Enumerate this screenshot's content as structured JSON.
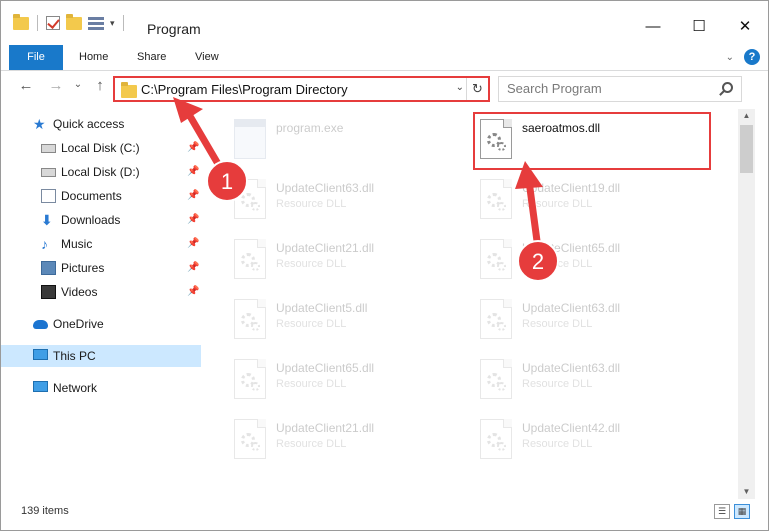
{
  "titlebar": {
    "title": "Program",
    "minimize": "—",
    "maximize": "☐",
    "close": "✕"
  },
  "ribbon": {
    "tabs": [
      "File",
      "Home",
      "Share",
      "View"
    ],
    "help": "?"
  },
  "nav": {
    "back": "←",
    "forward": "→",
    "recent": "⌄",
    "up": "↑",
    "address": "C:\\Program Files\\Program Directory",
    "search_placeholder": "Search Program"
  },
  "sidebar": {
    "items": [
      {
        "label": "Quick access",
        "icon": "star-icon",
        "pinned": false
      },
      {
        "label": "Local Disk (C:)",
        "icon": "drive-icon",
        "pinned": true
      },
      {
        "label": "Local Disk (D:)",
        "icon": "drive-icon",
        "pinned": true
      },
      {
        "label": "Documents",
        "icon": "documents-icon",
        "pinned": true
      },
      {
        "label": "Downloads",
        "icon": "download-icon",
        "pinned": true
      },
      {
        "label": "Music",
        "icon": "music-icon",
        "pinned": true
      },
      {
        "label": "Pictures",
        "icon": "pictures-icon",
        "pinned": true
      },
      {
        "label": "Videos",
        "icon": "videos-icon",
        "pinned": true
      },
      {
        "label": "OneDrive",
        "icon": "onedrive-icon",
        "pinned": false
      },
      {
        "label": "This PC",
        "icon": "this-pc-icon",
        "pinned": false,
        "selected": true
      },
      {
        "label": "Network",
        "icon": "network-icon",
        "pinned": false
      }
    ]
  },
  "files": [
    {
      "name": "program.exe",
      "type": "",
      "icon": "exe-icon",
      "dim": true
    },
    {
      "name": "saeroatmos.dll",
      "type": "",
      "icon": "dll-icon",
      "dim": false,
      "highlighted": true
    },
    {
      "name": "UpdateClient63.dll",
      "type": "Resource DLL",
      "icon": "dll-icon",
      "dim": true
    },
    {
      "name": "UpdateClient19.dll",
      "type": "Resource DLL",
      "icon": "dll-icon",
      "dim": true
    },
    {
      "name": "UpdateClient21.dll",
      "type": "Resource DLL",
      "icon": "dll-icon",
      "dim": true
    },
    {
      "name": "UpdateClient65.dll",
      "type": "Resource DLL",
      "icon": "dll-icon",
      "dim": true
    },
    {
      "name": "UpdateClient5.dll",
      "type": "Resource DLL",
      "icon": "dll-icon",
      "dim": true
    },
    {
      "name": "UpdateClient63.dll",
      "type": "Resource DLL",
      "icon": "dll-icon",
      "dim": true
    },
    {
      "name": "UpdateClient65.dll",
      "type": "Resource DLL",
      "icon": "dll-icon",
      "dim": true
    },
    {
      "name": "UpdateClient63.dll",
      "type": "Resource DLL",
      "icon": "dll-icon",
      "dim": true
    },
    {
      "name": "UpdateClient21.dll",
      "type": "Resource DLL",
      "icon": "dll-icon",
      "dim": true
    },
    {
      "name": "UpdateClient42.dll",
      "type": "Resource DLL",
      "icon": "dll-icon",
      "dim": true
    }
  ],
  "status": {
    "item_count": "139 items"
  },
  "annotations": {
    "step1": "1",
    "step2": "2",
    "color": "#e63c3c"
  },
  "colors": {
    "accent": "#1979ca",
    "selection": "#cce8ff",
    "annotation": "#e63c3c"
  }
}
